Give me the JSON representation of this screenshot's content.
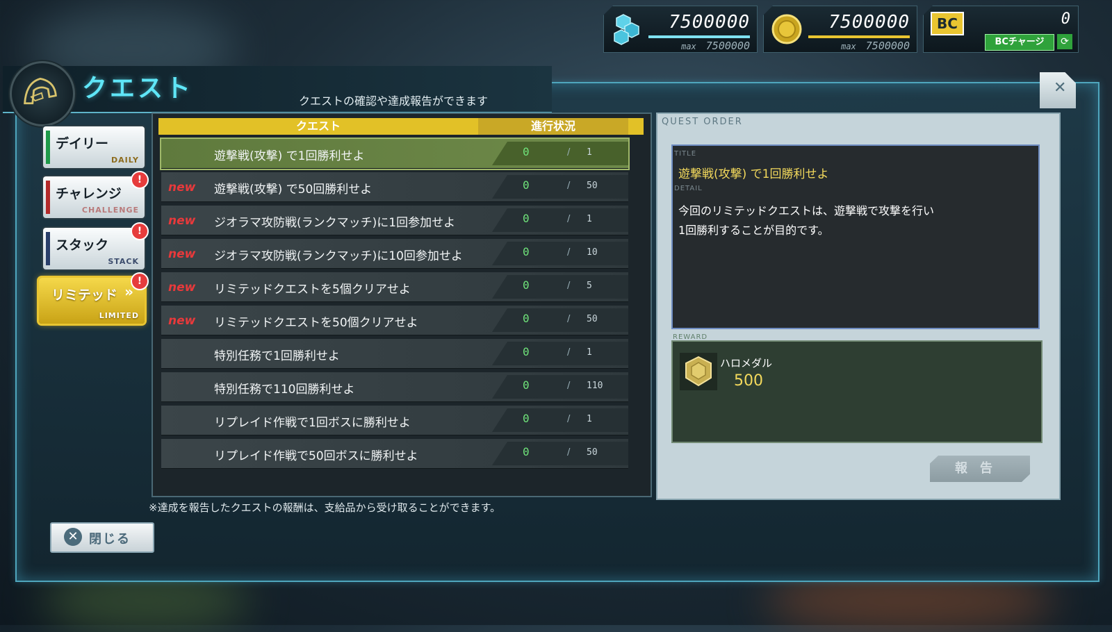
{
  "resources": [
    {
      "icon": "crystal-icon",
      "value": "7500000",
      "max_label": "max",
      "max": "7500000"
    },
    {
      "icon": "coin-icon",
      "value": "7500000",
      "max_label": "max",
      "max": "7500000"
    },
    {
      "icon": "bc-icon",
      "label": "BC",
      "value": "0",
      "charge_label": "BCチャージ"
    }
  ],
  "header": {
    "title": "クエスト",
    "subtitle": "クエストの確認や達成報告ができます"
  },
  "tabs": [
    {
      "jp": "デイリー",
      "en": "DAILY",
      "stripe": "#1f9a4a",
      "alert": false,
      "active": false
    },
    {
      "jp": "チャレンジ",
      "en": "CHALLENGE",
      "stripe": "#b42a2a",
      "alert": true,
      "active": false
    },
    {
      "jp": "スタック",
      "en": "STACK",
      "stripe": "#2a3f6a",
      "alert": true,
      "active": false
    },
    {
      "jp": "リミテッド",
      "en": "LIMITED",
      "stripe": "#e4c12b",
      "alert": true,
      "active": true
    }
  ],
  "alert_mark": "!",
  "table": {
    "col_quest": "クエスト",
    "col_progress": "進行状況",
    "slash": "/",
    "new_label": "new",
    "rows": [
      {
        "name": "遊撃戦(攻撃) で1回勝利せよ",
        "cur": "0",
        "target": "1",
        "is_new": false,
        "selected": true
      },
      {
        "name": "遊撃戦(攻撃) で50回勝利せよ",
        "cur": "0",
        "target": "50",
        "is_new": true,
        "selected": false
      },
      {
        "name": "ジオラマ攻防戦(ランクマッチ)に1回参加せよ",
        "cur": "0",
        "target": "1",
        "is_new": true,
        "selected": false
      },
      {
        "name": "ジオラマ攻防戦(ランクマッチ)に10回参加せよ",
        "cur": "0",
        "target": "10",
        "is_new": true,
        "selected": false
      },
      {
        "name": "リミテッドクエストを5個クリアせよ",
        "cur": "0",
        "target": "5",
        "is_new": true,
        "selected": false
      },
      {
        "name": "リミテッドクエストを50個クリアせよ",
        "cur": "0",
        "target": "50",
        "is_new": true,
        "selected": false
      },
      {
        "name": "特別任務で1回勝利せよ",
        "cur": "0",
        "target": "1",
        "is_new": false,
        "selected": false
      },
      {
        "name": "特別任務で110回勝利せよ",
        "cur": "0",
        "target": "110",
        "is_new": false,
        "selected": false
      },
      {
        "name": "リプレイド作戦で1回ボスに勝利せよ",
        "cur": "0",
        "target": "1",
        "is_new": false,
        "selected": false
      },
      {
        "name": "リプレイド作戦で50回ボスに勝利せよ",
        "cur": "0",
        "target": "50",
        "is_new": false,
        "selected": false
      }
    ]
  },
  "detail": {
    "header": "QUEST ORDER",
    "title_label": "TITLE",
    "title": "遊撃戦(攻撃) で1回勝利せよ",
    "detail_label": "DETAIL",
    "detail": "今回のリミテッドクエストは、遊撃戦で攻撃を行い\n1回勝利することが目的です。",
    "reward_label": "REWARD",
    "reward_name": "ハロメダル",
    "reward_amount": "500",
    "report_button": "報告"
  },
  "footer": {
    "note": "※達成を報告したクエストの報酬は、支給品から受け取ることができます。",
    "close_button": "閉じる",
    "close_icon": "close-icon"
  }
}
